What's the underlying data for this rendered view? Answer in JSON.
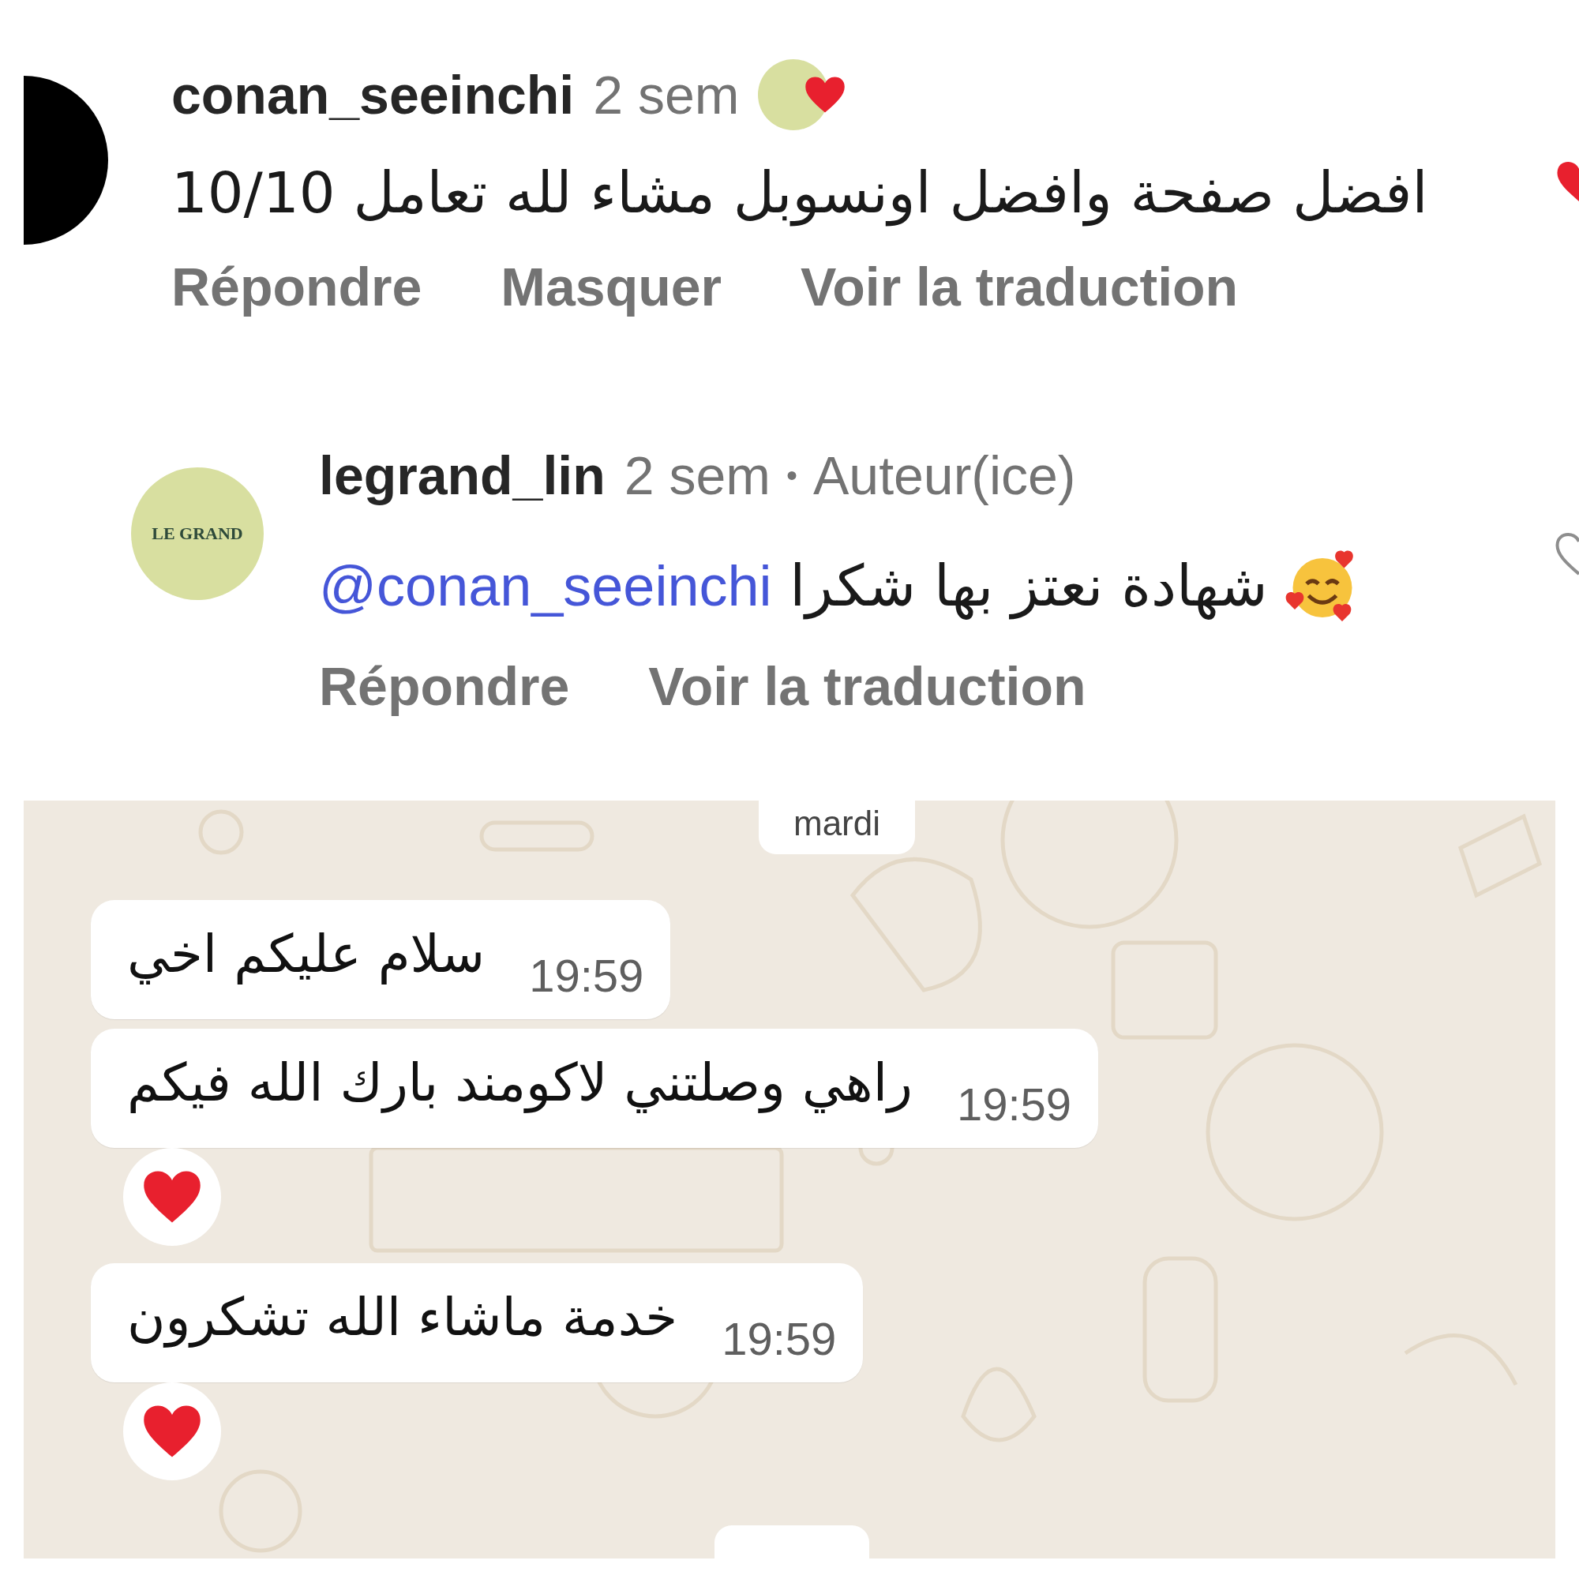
{
  "comments": [
    {
      "avatar": {
        "kind": "blank"
      },
      "username": "conan_seeinchi",
      "time": "2 sem",
      "liked_by_author": true,
      "text": "افضل صفحة وافضل اونسوبل مشاء لله تعامل 10/10",
      "actions": [
        "Répondre",
        "Masquer",
        "Voir la traduction"
      ],
      "liked": true
    },
    {
      "avatar": {
        "kind": "logo",
        "text": "LE GRAND"
      },
      "username": "legrand_lin",
      "time": "2 sem",
      "separator": "•",
      "badge": "Auteur(ice)",
      "mention": "@conan_seeinchi",
      "text": "شهادة نعتز بها شكرا",
      "emoji": true,
      "actions": [
        "Répondre",
        "Voir la traduction"
      ],
      "liked": false
    }
  ],
  "chat": {
    "date": "mardi",
    "messages": [
      {
        "text": "سلام عليكم اخي",
        "time": "19:59",
        "reaction": false
      },
      {
        "text": "راهي وصلتني لاكومند بارك الله فيكم",
        "time": "19:59",
        "reaction": true
      },
      {
        "text": "خدمة ماشاء الله تشكرون",
        "time": "19:59",
        "reaction": true
      }
    ]
  }
}
